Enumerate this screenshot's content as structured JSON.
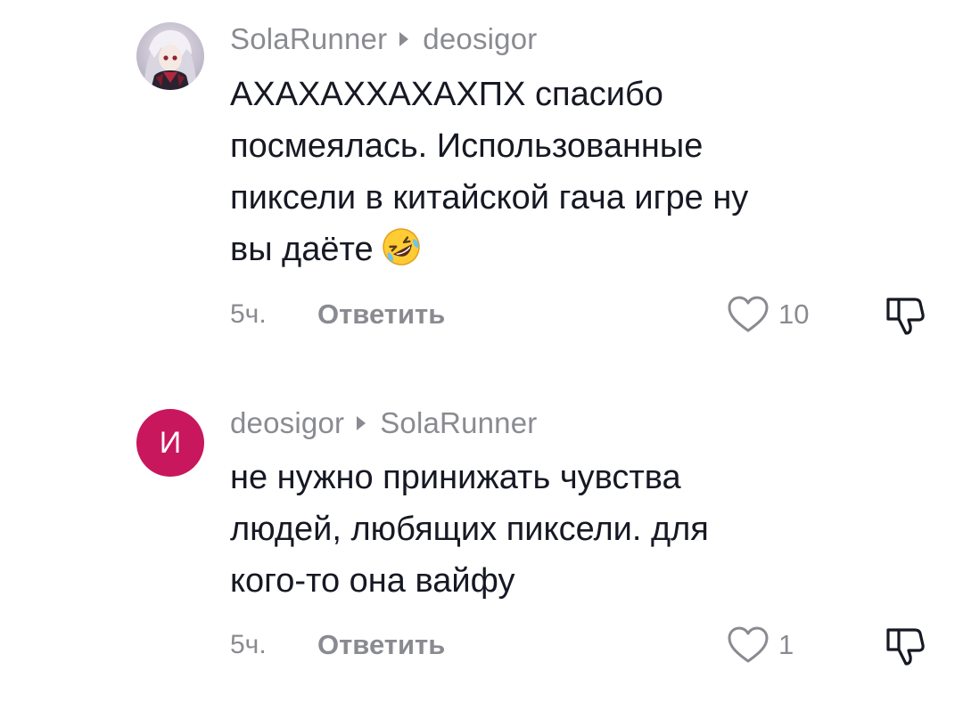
{
  "comments": [
    {
      "author": "SolaRunner",
      "reply_to": "deosigor",
      "text": "АХАХАХХАХАХПХ спасибо\nпосмеялась. Использованные\nпиксели в китайской гача игре ну\nвы даёте",
      "emoji_icon": "rolling-on-floor-laughing-emoji",
      "time": "5ч.",
      "reply_label": "Ответить",
      "likes": "10",
      "avatar_type": "anime-character-image"
    },
    {
      "author": "deosigor",
      "reply_to": "SolaRunner",
      "avatar_letter": "И",
      "avatar_color": "#c8175d",
      "text": "не нужно принижать чувства\nлюдей, любящих пиксели. для\nкого-то она вайфу",
      "time": "5ч.",
      "reply_label": "Ответить",
      "likes": "1"
    }
  ],
  "colors": {
    "text": "#161823",
    "muted": "#8a8b91",
    "background": "#ffffff"
  }
}
